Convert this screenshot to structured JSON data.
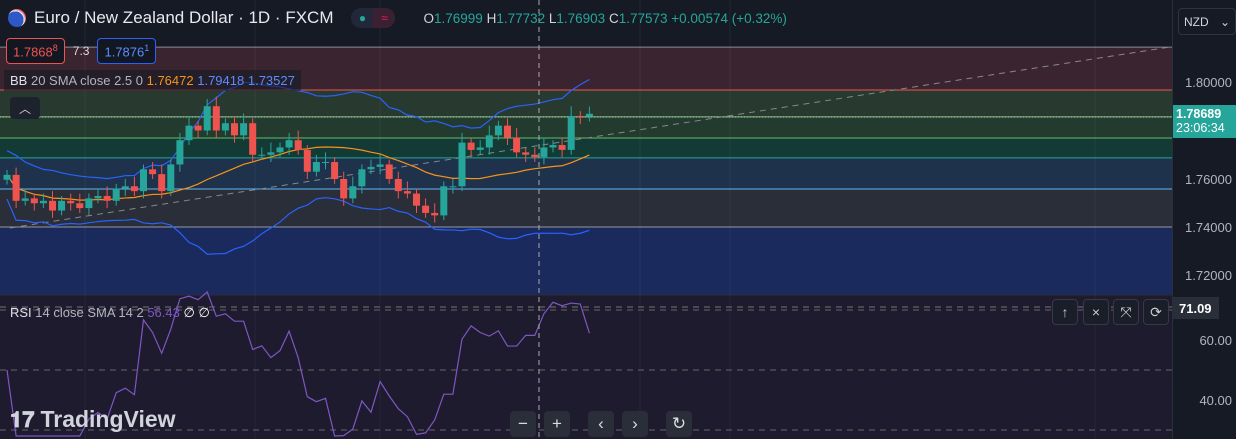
{
  "header": {
    "title": "Euro / New Zealand Dollar · 1D · FXCM",
    "O": "1.76999",
    "H": "1.77732",
    "L": "1.76903",
    "C": "1.77573",
    "change": "+0.00574 (+0.32%)",
    "status_icon": "market-open-dot",
    "wave_icon": "≈"
  },
  "order": {
    "sell": "1.7868",
    "sell_sup": "8",
    "spread": "7.3",
    "buy": "1.7876",
    "buy_sup": "1"
  },
  "bb": {
    "label": "BB",
    "params": "20 SMA close 2.5 0",
    "basis": "1.76472",
    "upper": "1.79418",
    "lower": "1.73527"
  },
  "rsi": {
    "label": "RSI",
    "params": "14 close SMA 14 2",
    "value": "56.43",
    "v2": "∅",
    "v3": "∅"
  },
  "axis": {
    "currency": "NZD",
    "price_labels": [
      "1.80000",
      "1.76000",
      "1.74000",
      "1.72000"
    ],
    "current_price": "1.78689",
    "countdown": "23:06:34",
    "rsi_labels": [
      "60.00",
      "40.00"
    ],
    "rsi_current": "71.09"
  },
  "pane_buttons": {
    "up": "↑",
    "close": "×",
    "maximize": "⤧",
    "settings": "⟳"
  },
  "nav": {
    "zoom_out": "−",
    "zoom_in": "+",
    "left": "‹",
    "right": "›",
    "reset": "↻"
  },
  "logo": "TradingView",
  "colors": {
    "up": "#26a69a",
    "down": "#ef5350",
    "bb_basis": "#f7931a",
    "bb_band": "#2962ff",
    "rsi": "#7e57c2"
  },
  "chart_data": {
    "type": "candlestick",
    "closes": [
      1.7617,
      1.751,
      1.752,
      1.75,
      1.751,
      1.747,
      1.751,
      1.75,
      1.748,
      1.752,
      1.753,
      1.751,
      1.756,
      1.757,
      1.755,
      1.764,
      1.762,
      1.755,
      1.766,
      1.776,
      1.782,
      1.78,
      1.79,
      1.78,
      1.783,
      1.778,
      1.783,
      1.77,
      1.77,
      1.771,
      1.773,
      1.776,
      1.772,
      1.763,
      1.767,
      1.767,
      1.76,
      1.752,
      1.757,
      1.764,
      1.765,
      1.766,
      1.76,
      1.755,
      1.754,
      1.749,
      1.746,
      1.745,
      1.757,
      1.757,
      1.775,
      1.772,
      1.773,
      1.778,
      1.782,
      1.777,
      1.771,
      1.77,
      1.769,
      1.773,
      1.774,
      1.772,
      1.786,
      1.7857,
      1.7869
    ],
    "price_range": [
      1.705,
      1.825
    ],
    "rsi_range": [
      28,
      76
    ]
  }
}
